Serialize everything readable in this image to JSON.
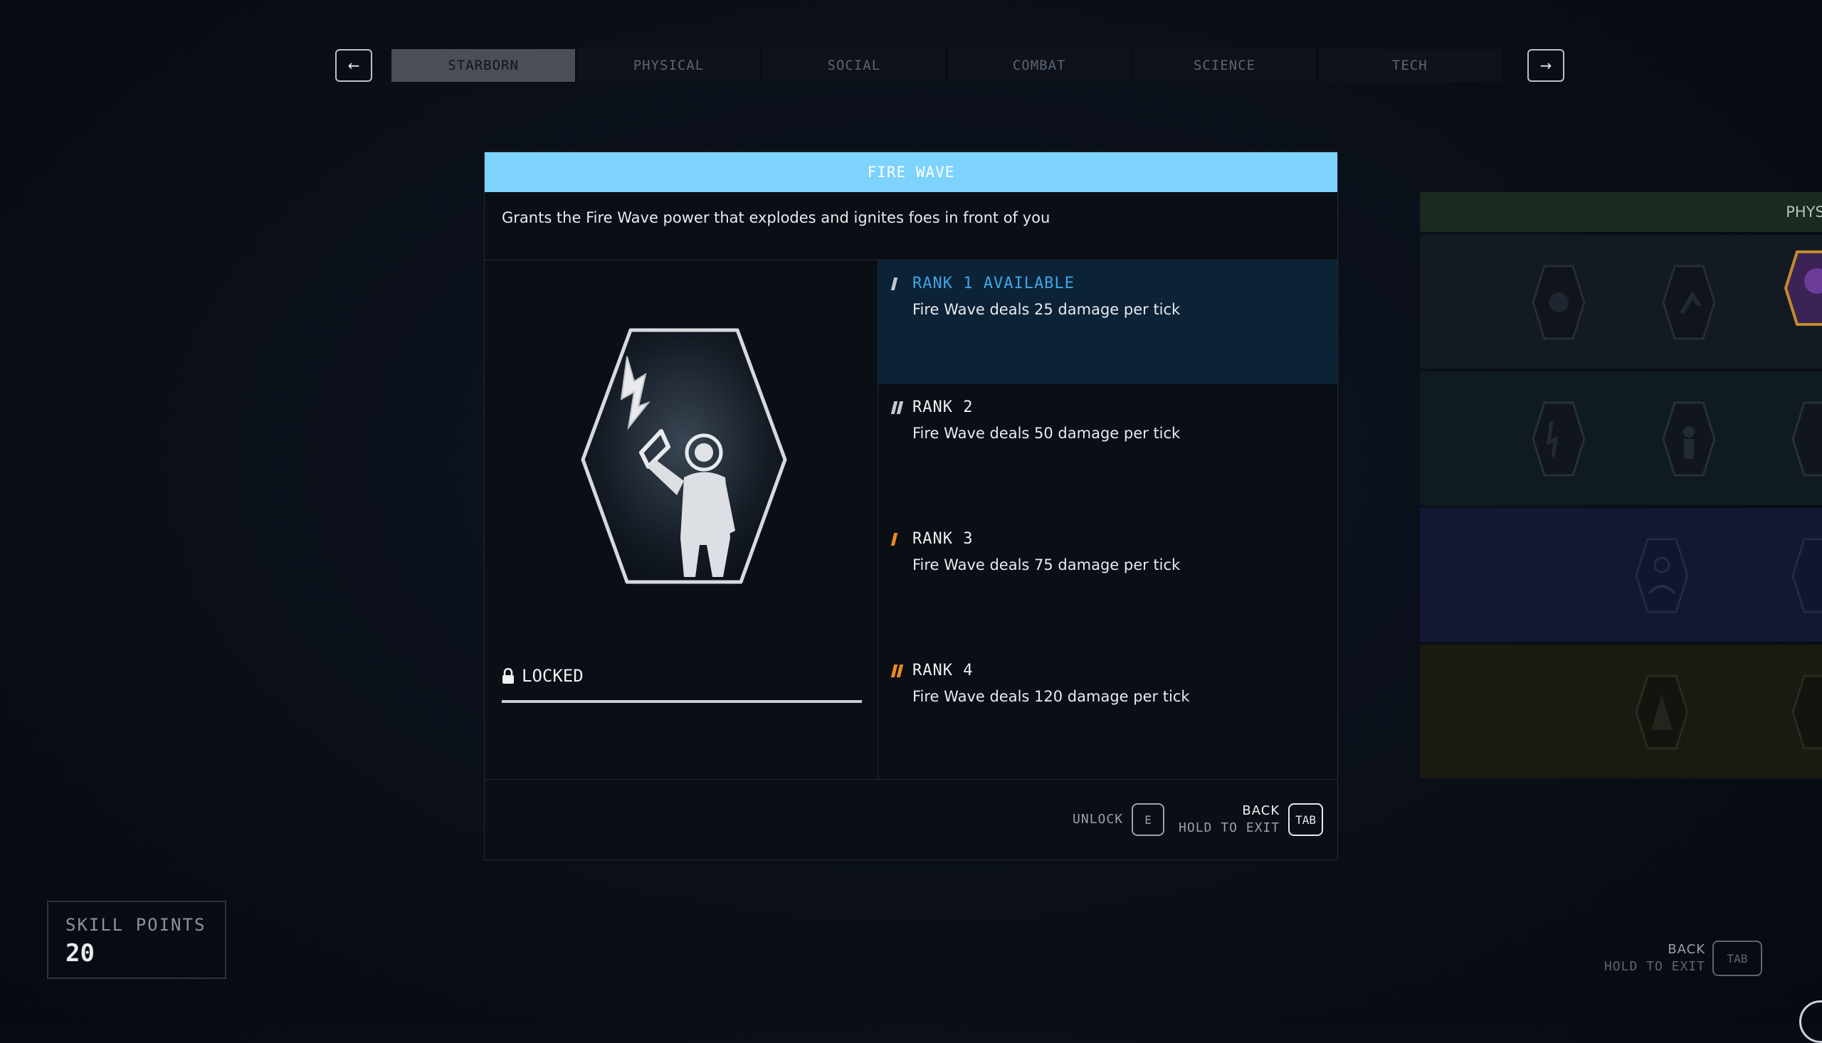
{
  "nav": {
    "prev_icon": "arrow-left-icon",
    "next_icon": "arrow-right-icon",
    "prev_glyph": "←",
    "next_glyph": "→",
    "tabs": [
      {
        "label": "STARBORN",
        "active": true
      },
      {
        "label": "PHYSICAL",
        "active": false
      },
      {
        "label": "SOCIAL",
        "active": false
      },
      {
        "label": "COMBAT",
        "active": false
      },
      {
        "label": "SCIENCE",
        "active": false
      },
      {
        "label": "TECH",
        "active": false
      }
    ]
  },
  "skill": {
    "title": "FIRE WAVE",
    "description": "Grants the Fire Wave power that explodes and ignites foes in front of you",
    "status": "LOCKED",
    "icon": "astronaut-lightning-badge-icon",
    "ranks": [
      {
        "title": "RANK 1 AVAILABLE",
        "text": "Fire Wave deals 25 damage per tick",
        "marks": 1,
        "active": true
      },
      {
        "title": "RANK 2",
        "text": "Fire Wave deals 50 damage per tick",
        "marks": 2,
        "active": false
      },
      {
        "title": "RANK 3",
        "text": "Fire Wave deals 75 damage per tick",
        "marks": 1,
        "active": false
      },
      {
        "title": "RANK 4",
        "text": "Fire Wave deals 120 damage per tick",
        "marks": 2,
        "active": false
      }
    ]
  },
  "footer": {
    "unlock_label": "UNLOCK",
    "unlock_key": "E",
    "back_label": "BACK",
    "hold_label": "HOLD TO EXIT",
    "back_key": "TAB"
  },
  "tree": {
    "header": "PHYSI"
  },
  "skill_points": {
    "label": "SKILL POINTS",
    "value": "20"
  },
  "bottom_hint": {
    "back_label": "BACK",
    "hold_label": "HOLD TO EXIT",
    "key": "TAB"
  },
  "colors": {
    "accent": "#7dd3fb",
    "rank_available": "#3fa6e8",
    "rank_mark_orange": "#f08a1e",
    "background": "#0a0f18"
  }
}
